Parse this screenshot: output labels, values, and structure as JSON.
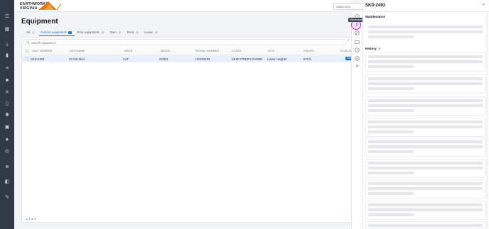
{
  "header": {
    "logo_line1": "EARTHWORKS",
    "logo_line2": "VIRGINIA",
    "company_select_placeholder": "Select one",
    "brand_orange": "#e07a1f"
  },
  "page": {
    "title": "Equipment",
    "tabs": [
      {
        "label": "All",
        "count": "1"
      },
      {
        "label": "Current equipment",
        "count": "1"
      },
      {
        "label": "Prior equipment",
        "count": "0"
      },
      {
        "label": "Own",
        "count": "1"
      },
      {
        "label": "Rent",
        "count": "0"
      },
      {
        "label": "Lease",
        "count": "0"
      }
    ],
    "active_tab": "Current equipment",
    "search_placeholder": "Search equipment",
    "filter_letter": "S"
  },
  "table": {
    "columns": [
      "UNIT NUMBER",
      "NICKNAME",
      "MAKE",
      "MODEL",
      "SERIAL NUMBER",
      "CLASS",
      "SITE",
      "HOURS",
      "STATUS"
    ],
    "rows": [
      {
        "unit_number": "SKD-2493",
        "nickname": "22 Cat Skid",
        "make": "CAT",
        "model": "242D3",
        "serial_number": "HSX02493",
        "class": "SKID STEER LOADER",
        "site": "Lanier Heights",
        "hours": "670.0",
        "status": "Available"
      }
    ],
    "pagination": "1–1 of 1"
  },
  "icon_strip": {
    "tooltip": "Maintenance",
    "icons": [
      "info-icon",
      "wrench-icon",
      "blocked-icon",
      "folder-icon",
      "history-icon",
      "check-circle-icon",
      "signal-icon"
    ]
  },
  "drawer": {
    "title": "SKD-2493",
    "maintenance_label": "Maintenance",
    "history_label": "History",
    "history_count": "0"
  },
  "colors": {
    "rail": "#2f3a46",
    "accent": "#1769c2",
    "highlight": "#c026d3"
  }
}
